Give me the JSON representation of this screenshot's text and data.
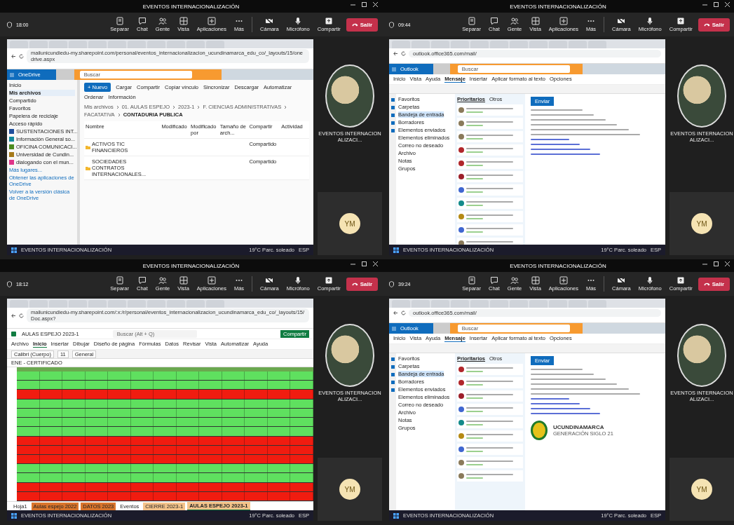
{
  "panes": [
    {
      "title": "EVENTOS INTERNACIONALIZACIÓN",
      "time": "18:00",
      "controls": [
        {
          "label": "Separar",
          "kind": "popout"
        },
        {
          "label": "Chat",
          "kind": "chat"
        },
        {
          "label": "Gente",
          "kind": "people"
        },
        {
          "label": "Vista",
          "kind": "grid"
        },
        {
          "label": "Aplicaciones",
          "kind": "plus"
        },
        {
          "label": "Más",
          "kind": "more"
        },
        {
          "label": "Cámara",
          "kind": "camera"
        },
        {
          "label": "Micrófono",
          "kind": "mic"
        },
        {
          "label": "Compartir",
          "kind": "share"
        }
      ],
      "leave": "Salir",
      "screen": {
        "kind": "onedrive",
        "url": "mailunicundiedu-my.sharepoint.com/personal/eventos_internacionalizacion_ucundinamarca_edu_co/_layouts/15/onedrive.aspx",
        "app": "OneDrive",
        "search": "Buscar",
        "nav": [
          {
            "label": "Inicio",
            "selected": false
          },
          {
            "label": "Mis archivos",
            "selected": true
          },
          {
            "label": "Compartido",
            "selected": false
          },
          {
            "label": "Favoritos",
            "selected": false
          },
          {
            "label": "Papelera de reciclaje",
            "selected": false
          }
        ],
        "quick_title": "Acceso rápido",
        "quick": [
          {
            "label": "SUSTENTACIONES INT...",
            "color": "#1f4e9c"
          },
          {
            "label": "Información General so...",
            "color": "#138a9e"
          },
          {
            "label": "OFICINA COMUNICACI...",
            "color": "#4b8a1e"
          },
          {
            "label": "Universidad de Cundin...",
            "color": "#a57a1a"
          },
          {
            "label": "dialogando con el mun...",
            "color": "#e0358a"
          }
        ],
        "more": "Más lugares...",
        "footer_links": [
          "Obtener las aplicaciones de OneDrive",
          "Volver a la versión clásica de OneDrive"
        ],
        "new": "+ Nuevo",
        "commands": [
          "Cargar",
          "Compartir",
          "Copiar vínculo",
          "Sincronizar",
          "Descargar",
          "Automatizar"
        ],
        "commands_right": [
          "Ordenar",
          "Información"
        ],
        "breadcrumb": [
          "Mis archivos",
          "01. AULAS ESPEJO",
          "2023-1",
          "F. CIENCIAS ADMINISTRATIVAS",
          "FACATATIVA",
          "CONTADURIA PUBLICA"
        ],
        "columns": [
          "Nombre",
          "Modificado",
          "Modificado por",
          "Tamaño de arch...",
          "Compartir",
          "Actividad"
        ],
        "rows": [
          {
            "name": "ACTIVOS TIC FINANCIEROS",
            "sharing": "Compartido"
          },
          {
            "name": "SOCIEDADES CONTRATOS INTERNACIONALES...",
            "sharing": "Compartido"
          }
        ]
      },
      "participant": "EVENTOS INTERNACIONALIZACI...",
      "avatar": "YM",
      "taskbar": {
        "label": "EVENTOS INTERNACIONALIZACIÓN",
        "weather": "19°C Parc. soleado",
        "lang": "ESP"
      }
    },
    {
      "title": "EVENTOS INTERNACIONALIZACIÓN",
      "time": "09:44",
      "controls": [
        {
          "label": "Separar",
          "kind": "popout"
        },
        {
          "label": "Chat",
          "kind": "chat"
        },
        {
          "label": "Gente",
          "kind": "people"
        },
        {
          "label": "Vista",
          "kind": "grid"
        },
        {
          "label": "Aplicaciones",
          "kind": "plus"
        },
        {
          "label": "Más",
          "kind": "more"
        },
        {
          "label": "Cámara",
          "kind": "camera"
        },
        {
          "label": "Micrófono",
          "kind": "mic"
        },
        {
          "label": "Compartir",
          "kind": "share"
        }
      ],
      "leave": "Salir",
      "screen": {
        "kind": "outlook",
        "url": "outlook.office365.com/mail/",
        "app": "Outlook",
        "search": "Buscar",
        "ribbon": [
          {
            "label": "Inicio",
            "selected": false
          },
          {
            "label": "Vista",
            "selected": false
          },
          {
            "label": "Ayuda",
            "selected": false
          },
          {
            "label": "Mensaje",
            "selected": true
          },
          {
            "label": "Insertar",
            "selected": false
          },
          {
            "label": "Aplicar formato al texto",
            "selected": false
          },
          {
            "label": "Opciones",
            "selected": false
          }
        ],
        "folders": [
          {
            "label": "Favoritos",
            "selected": false
          },
          {
            "label": "Carpetas",
            "selected": false
          },
          {
            "label": "Bandeja de entrada",
            "selected": true
          },
          {
            "label": "Borradores",
            "selected": false
          },
          {
            "label": "Elementos enviados",
            "selected": false
          },
          {
            "label": "Elementos eliminados",
            "selected": false
          },
          {
            "label": "Correo no deseado",
            "selected": false
          },
          {
            "label": "Archivo",
            "selected": false
          },
          {
            "label": "Notas",
            "selected": false
          },
          {
            "label": "Grupos",
            "selected": false
          }
        ],
        "list_tabs": [
          {
            "label": "Prioritarios",
            "selected": true
          },
          {
            "label": "Otros",
            "selected": false
          }
        ],
        "messages": [
          {
            "color": "#8a7a5a"
          },
          {
            "color": "#8a7a5a"
          },
          {
            "color": "#8a7a5a"
          },
          {
            "color": "#b0262b"
          },
          {
            "color": "#b0262b"
          },
          {
            "color": "#9c1f2a"
          },
          {
            "color": "#3f66d0"
          },
          {
            "color": "#128a8a"
          },
          {
            "color": "#b58a14"
          },
          {
            "color": "#3f66d0"
          },
          {
            "color": "#8a7a5a"
          }
        ],
        "send": "Enviar"
      },
      "participant": "EVENTOS INTERNACIONALIZACI...",
      "avatar": "YM",
      "taskbar": {
        "label": "EVENTOS INTERNACIONALIZACIÓN",
        "weather": "19°C Parc. soleado",
        "lang": "ESP"
      }
    },
    {
      "title": "EVENTOS INTERNACIONALIZACIÓN",
      "time": "18:12",
      "controls": [
        {
          "label": "Separar",
          "kind": "popout"
        },
        {
          "label": "Chat",
          "kind": "chat"
        },
        {
          "label": "Gente",
          "kind": "people"
        },
        {
          "label": "Vista",
          "kind": "grid"
        },
        {
          "label": "Aplicaciones",
          "kind": "plus"
        },
        {
          "label": "Más",
          "kind": "more"
        },
        {
          "label": "Cámara",
          "kind": "camera"
        },
        {
          "label": "Micrófono",
          "kind": "mic"
        },
        {
          "label": "Compartir",
          "kind": "share"
        }
      ],
      "leave": "Salir",
      "screen": {
        "kind": "excel",
        "url": "mailunicundiedu-my.sharepoint.com/:x:/r/personal/eventos_internacionalizacion_ucundinamarca_edu_co/_layouts/15/Doc.aspx?",
        "file": "AULAS ESPEJO 2023-1",
        "search": "Buscar (Alt + Q)",
        "ribbon": [
          {
            "label": "Archivo",
            "selected": false
          },
          {
            "label": "Inicio",
            "selected": true
          },
          {
            "label": "Insertar",
            "selected": false
          },
          {
            "label": "Dibujar",
            "selected": false
          },
          {
            "label": "Diseño de página",
            "selected": false
          },
          {
            "label": "Fórmulas",
            "selected": false
          },
          {
            "label": "Datos",
            "selected": false
          },
          {
            "label": "Revisar",
            "selected": false
          },
          {
            "label": "Vista",
            "selected": false
          },
          {
            "label": "Automatizar",
            "selected": false
          },
          {
            "label": "Ayuda",
            "selected": false
          }
        ],
        "share": "Compartir",
        "font": "Calibri (Cuerpo)",
        "size": "11",
        "format": "General",
        "formula": "ENE - CERTIFICADO",
        "rows": [
          {
            "color": "#5fe05f"
          },
          {
            "color": "#5fe05f"
          },
          {
            "color": "#f01c10"
          },
          {
            "color": "#5fe05f"
          },
          {
            "color": "#5fe05f"
          },
          {
            "color": "#5fe05f"
          },
          {
            "color": "#5fe05f"
          },
          {
            "color": "#f01c10"
          },
          {
            "color": "#f01c10"
          },
          {
            "color": "#f01c10"
          },
          {
            "color": "#5fe05f"
          },
          {
            "color": "#5fe05f"
          },
          {
            "color": "#f01c10"
          },
          {
            "color": "#f01c10"
          }
        ],
        "sheets": [
          {
            "label": "Hoja1",
            "color": "#ffffff",
            "selected": false
          },
          {
            "label": "Aulas espejo 2022",
            "color": "#d9752c",
            "selected": false
          },
          {
            "label": "DATOS 2023",
            "color": "#d9752c",
            "selected": false
          },
          {
            "label": "Eventos",
            "color": "#ffffff",
            "selected": false
          },
          {
            "label": "CIERRE 2023-1",
            "color": "#f4c38a",
            "selected": false
          },
          {
            "label": "AULAS ESPEJO 2023-1",
            "color": "#f4c38a",
            "selected": true
          }
        ]
      },
      "participant": "EVENTOS INTERNACIONALIZACI...",
      "avatar": "YM",
      "taskbar": {
        "label": "EVENTOS INTERNACIONALIZACIÓN",
        "weather": "19°C Parc. soleado",
        "lang": "ESP"
      }
    },
    {
      "title": "EVENTOS INTERNACIONALIZACIÓN",
      "time": "39:24",
      "controls": [
        {
          "label": "Separar",
          "kind": "popout"
        },
        {
          "label": "Chat",
          "kind": "chat"
        },
        {
          "label": "Gente",
          "kind": "people"
        },
        {
          "label": "Vista",
          "kind": "grid"
        },
        {
          "label": "Aplicaciones",
          "kind": "plus"
        },
        {
          "label": "Más",
          "kind": "more"
        },
        {
          "label": "Cámara",
          "kind": "camera"
        },
        {
          "label": "Micrófono",
          "kind": "mic"
        },
        {
          "label": "Compartir",
          "kind": "share"
        }
      ],
      "leave": "Salir",
      "screen": {
        "kind": "outlook",
        "url": "outlook.office365.com/mail/",
        "app": "Outlook",
        "search": "Buscar",
        "ribbon": [
          {
            "label": "Inicio",
            "selected": false
          },
          {
            "label": "Vista",
            "selected": false
          },
          {
            "label": "Ayuda",
            "selected": false
          },
          {
            "label": "Mensaje",
            "selected": true
          },
          {
            "label": "Insertar",
            "selected": false
          },
          {
            "label": "Aplicar formato al texto",
            "selected": false
          },
          {
            "label": "Opciones",
            "selected": false
          }
        ],
        "folders": [
          {
            "label": "Favoritos",
            "selected": false
          },
          {
            "label": "Carpetas",
            "selected": false
          },
          {
            "label": "Bandeja de entrada",
            "selected": true
          },
          {
            "label": "Borradores",
            "selected": false
          },
          {
            "label": "Elementos enviados",
            "selected": false
          },
          {
            "label": "Elementos eliminados",
            "selected": false
          },
          {
            "label": "Correo no deseado",
            "selected": false
          },
          {
            "label": "Archivo",
            "selected": false
          },
          {
            "label": "Notas",
            "selected": false
          },
          {
            "label": "Grupos",
            "selected": false
          }
        ],
        "list_tabs": [
          {
            "label": "Prioritarios",
            "selected": true
          },
          {
            "label": "Otros",
            "selected": false
          }
        ],
        "messages": [
          {
            "color": "#b0262b"
          },
          {
            "color": "#b0262b"
          },
          {
            "color": "#9c1f2a"
          },
          {
            "color": "#3f66d0"
          },
          {
            "color": "#128a8a"
          },
          {
            "color": "#b58a14"
          },
          {
            "color": "#3f66d0"
          },
          {
            "color": "#8a7a5a"
          },
          {
            "color": "#8a7a5a"
          }
        ],
        "send": "Enviar",
        "signature": {
          "org": "UCUNDINAMARCA",
          "tagline": "GENERACIÓN SIGLO 21"
        }
      },
      "participant": "EVENTOS INTERNACIONALIZACI...",
      "avatar": "YM",
      "taskbar": {
        "label": "EVENTOS INTERNACIONALIZACIÓN",
        "weather": "19°C Parc. soleado",
        "lang": "ESP"
      }
    }
  ]
}
